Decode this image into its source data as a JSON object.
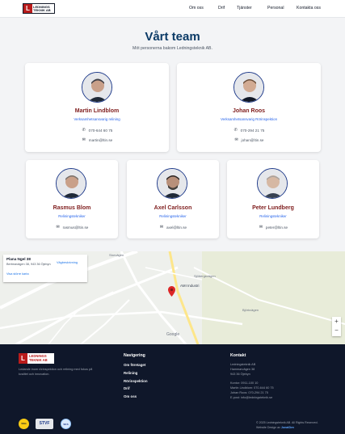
{
  "header": {
    "logo_mark": "L",
    "logo_text": "LEDNINGS\nTEKNIK AB",
    "nav": [
      {
        "label": "Om oss"
      },
      {
        "label": "Drif"
      },
      {
        "label": "Tjänster"
      },
      {
        "label": "Personal"
      },
      {
        "label": "Kontakta oss"
      }
    ]
  },
  "team": {
    "title": "Vårt team",
    "subtitle": "Möt personerna bakom Ledningsteknik AB.",
    "members": [
      {
        "name": "Martin Lindblom",
        "role": "Verksamhetsansvarig relining",
        "phone": "070-644 60 75",
        "email": "martin@ltin.se"
      },
      {
        "name": "Johan Roos",
        "role": "Verksamhetsansvarig Rörinspektion",
        "phone": "070-294 21 75",
        "email": "johan@ltin.se"
      },
      {
        "name": "Rasmus Blom",
        "role": "Reliningstekniker",
        "phone": "",
        "email": "rasmus@ltin.se"
      },
      {
        "name": "Axel Carlsson",
        "role": "Reliningstekniker",
        "phone": "",
        "email": "axel@ltin.se"
      },
      {
        "name": "Peter Lundberg",
        "role": "Reliningstekniker",
        "phone": "",
        "email": "peter@ltin.se"
      }
    ]
  },
  "map": {
    "popup_title": "Plana Ngel 38",
    "popup_address": "Bertmavägen 38, 943 36 Öjebyn",
    "directions_label": "Vägbeskrivning",
    "larger_map_label": "Visa större karta",
    "pin_label": "AMI Industri",
    "street_labels": [
      "Storvägen",
      "Sjöbergsvägen",
      "Björkvägen"
    ],
    "google_label": "Google",
    "zoom_in": "+",
    "zoom_out": "−"
  },
  "footer": {
    "logo_mark": "L",
    "logo_text": "LEDNINGS\nTEKNIK AB",
    "description": "Ledande inom rörinspektion och relining med fokus på kvalitet och innovation.",
    "nav_heading": "Navigering",
    "nav_links": [
      "Om företaget",
      "Relining",
      "Rörinspektion",
      "Drif",
      "Om oss"
    ],
    "contact_heading": "Kontakt",
    "contact_lines": [
      "Ledningsteknik AB",
      "Hammarvägen 38",
      "943 36 Öjebyn",
      "",
      "Kontor: 0911-100 10",
      "Martin Lindblom: 070-644 60 75",
      "Johan Roos: 070-294 21 75",
      "E-post: info@ledningsteknik.se"
    ],
    "badges": [
      {
        "label": "SSG",
        "color": "#facc15"
      },
      {
        "label": "STVF",
        "color": "#e5e7eb"
      },
      {
        "label": "SKS",
        "color": "#dbeafe"
      }
    ],
    "copyright": "© 2025 Ledningsteknik AB. All Rights Reserved.",
    "credit_prefix": "Website Design av ",
    "credit_name": "JonatDev"
  }
}
